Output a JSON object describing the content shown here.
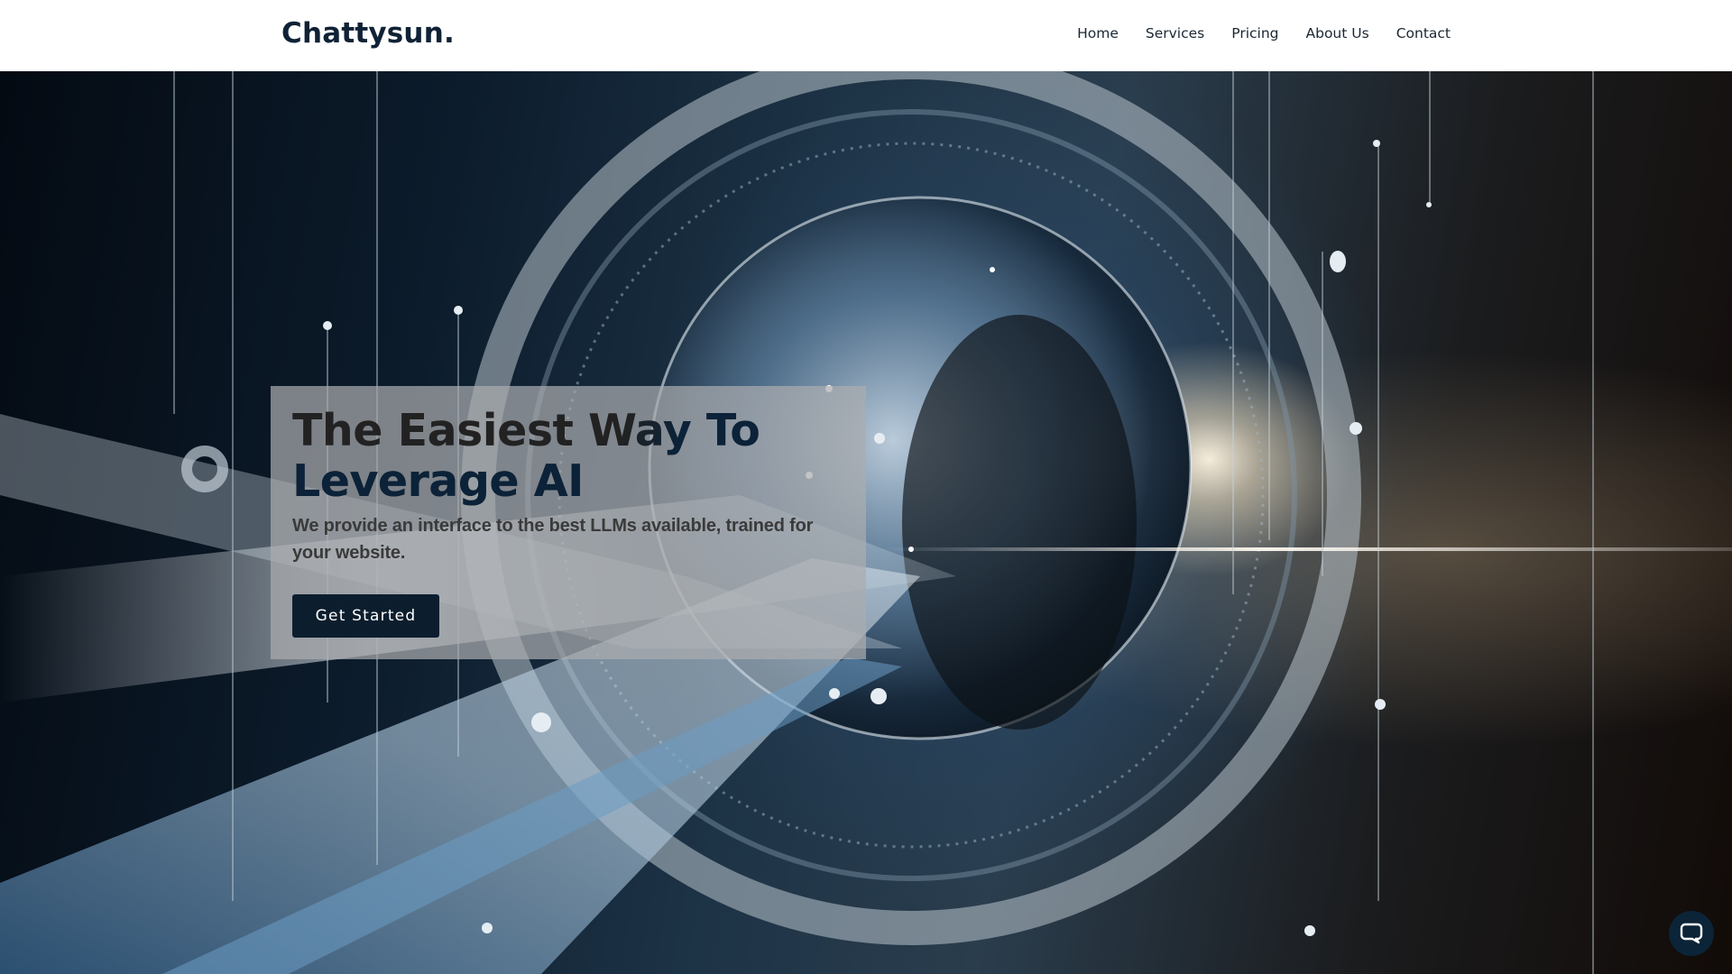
{
  "header": {
    "logo": "Chattysun.",
    "nav": [
      {
        "label": "Home"
      },
      {
        "label": "Services"
      },
      {
        "label": "Pricing"
      },
      {
        "label": "About Us"
      },
      {
        "label": "Contact"
      }
    ]
  },
  "hero": {
    "title_line1": "The Easiest Way To",
    "title_line2": "Leverage AI",
    "subtitle": "We provide an interface to the best LLMs available, trained for your website.",
    "cta_label": "Get Started",
    "background": "abstract-ai-lens-illustration"
  },
  "chat": {
    "icon": "chat-bubble-icon",
    "color": "#0b2438"
  },
  "colors": {
    "brand_dark": "#0c1e2e",
    "header_bg": "#ffffff",
    "heading_dark": "#222222",
    "heading_navy": "#0b2238"
  }
}
